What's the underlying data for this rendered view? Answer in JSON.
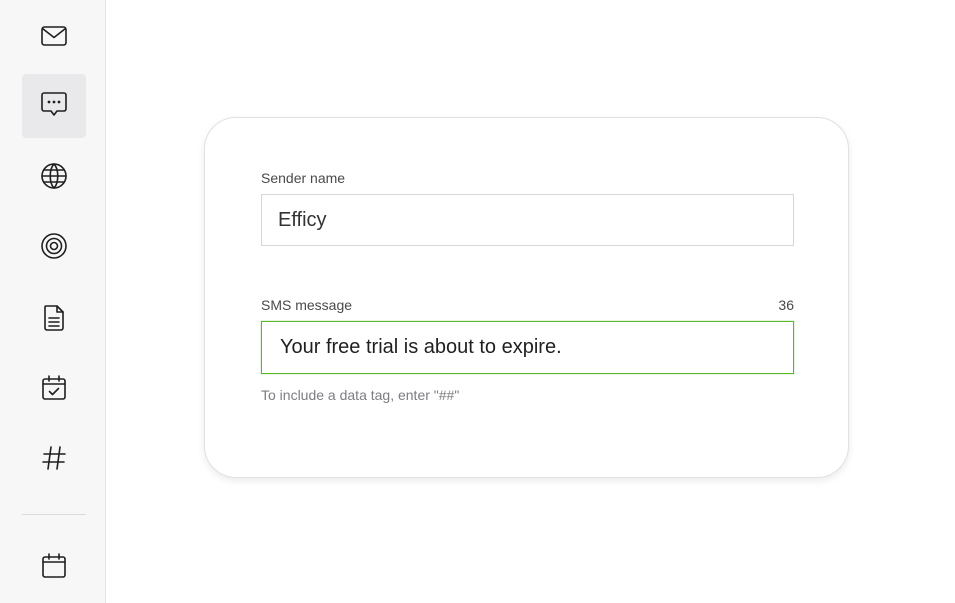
{
  "sidebar": {
    "items": [
      {
        "icon": "envelope-icon",
        "active": false
      },
      {
        "icon": "chat-bubble-icon",
        "active": true
      },
      {
        "icon": "globe-icon",
        "active": false
      },
      {
        "icon": "target-icon",
        "active": false
      },
      {
        "icon": "document-icon",
        "active": false
      },
      {
        "icon": "calendar-check-icon",
        "active": false
      },
      {
        "icon": "hashtag-icon",
        "active": false
      },
      {
        "icon": "calendar-icon",
        "active": false
      }
    ]
  },
  "form": {
    "sender_label": "Sender name",
    "sender_value": "Efficy",
    "sms_label": "SMS message",
    "sms_counter": "36",
    "sms_value": "Your free trial is about to expire.",
    "help_text": "To include a data tag, enter \"##\""
  },
  "colors": {
    "sidebar_bg": "#f7f7f8",
    "active_item_bg": "#e9e9eb",
    "focus_border": "#5cb82d",
    "help_text": "#7d7d82"
  }
}
